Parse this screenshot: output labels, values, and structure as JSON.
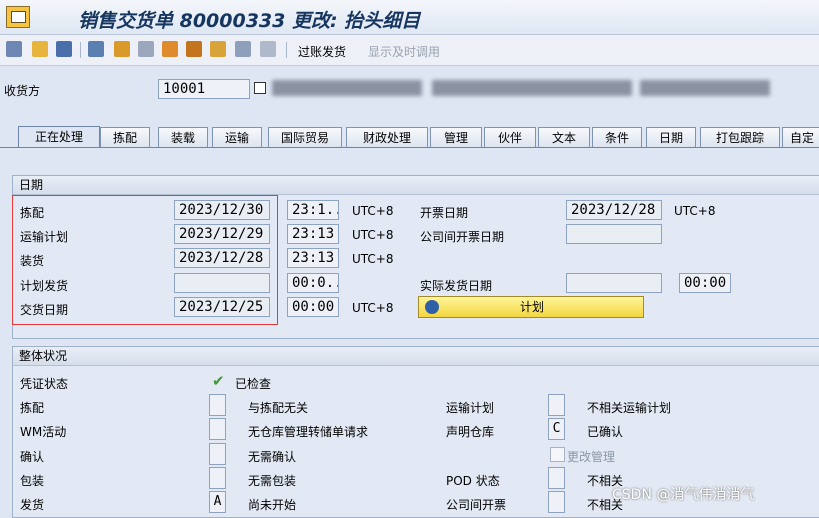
{
  "window": {
    "title": "销售交货单 80000333 更改: 抬头细目"
  },
  "toolbar": {
    "icons": [
      "glasses-icon",
      "document-icon",
      "trash-icon",
      "hierarchy-icon",
      "person-icon",
      "printer-icon",
      "notes-icon",
      "box-icon",
      "list-icon",
      "flow-icon",
      "grid-icon"
    ],
    "post_goods_label": "过账发货",
    "display_timely_label": "显示及时调用"
  },
  "ship_to": {
    "label": "收货方",
    "value": "10001"
  },
  "tabs": [
    "正在处理",
    "拣配",
    "装载",
    "运输",
    "国际贸易",
    "财政处理",
    "管理",
    "伙伴",
    "文本",
    "条件",
    "日期",
    "打包跟踪",
    "自定"
  ],
  "dates": {
    "section_title": "日期",
    "rows": [
      {
        "label": "拣配",
        "date": "2023/12/30",
        "time": "23:1..",
        "tz": "UTC+8"
      },
      {
        "label": "运输计划",
        "date": "2023/12/29",
        "time": "23:13",
        "tz": "UTC+8"
      },
      {
        "label": "装货",
        "date": "2023/12/28",
        "time": "23:13",
        "tz": "UTC+8"
      },
      {
        "label": "计划发货",
        "date": "",
        "time": "00:0..",
        "tz": ""
      },
      {
        "label": "交货日期",
        "date": "2023/12/25",
        "time": "00:00",
        "tz": "UTC+8"
      }
    ],
    "billing_date_label": "开票日期",
    "billing_date": "2023/12/28",
    "billing_tz": "UTC+8",
    "intercompany_billing_label": "公司间开票日期",
    "intercompany_billing_date": "",
    "actual_gi_label": "实际发货日期",
    "actual_gi_date": "",
    "actual_gi_time": "00:00",
    "plan_button": "计划"
  },
  "status": {
    "section_title": "整体状况",
    "doc_status_label": "凭证状态",
    "doc_status_value": "已检查",
    "rows_left": [
      {
        "label": "拣配",
        "code": "",
        "text": "与拣配无关"
      },
      {
        "label": "WM活动",
        "code": "",
        "text": "无仓库管理转储单请求"
      },
      {
        "label": "确认",
        "code": "",
        "text": "无需确认"
      },
      {
        "label": "包装",
        "code": "",
        "text": "无需包装"
      },
      {
        "label": "发货",
        "code": "A",
        "text": "尚未开始"
      }
    ],
    "rows_right": [
      {
        "label": "运输计划",
        "code": "",
        "text": "不相关运输计划"
      },
      {
        "label": "声明仓库",
        "code": "C",
        "text": "已确认"
      },
      {
        "label": "",
        "code": "",
        "text": ""
      },
      {
        "label": "POD 状态",
        "code": "",
        "text": "不相关"
      },
      {
        "label": "公司间开票",
        "code": "",
        "text": "不相关"
      }
    ],
    "change_mgmt_label": "更改管理"
  },
  "watermark": "CSDN @消气伟消消气"
}
